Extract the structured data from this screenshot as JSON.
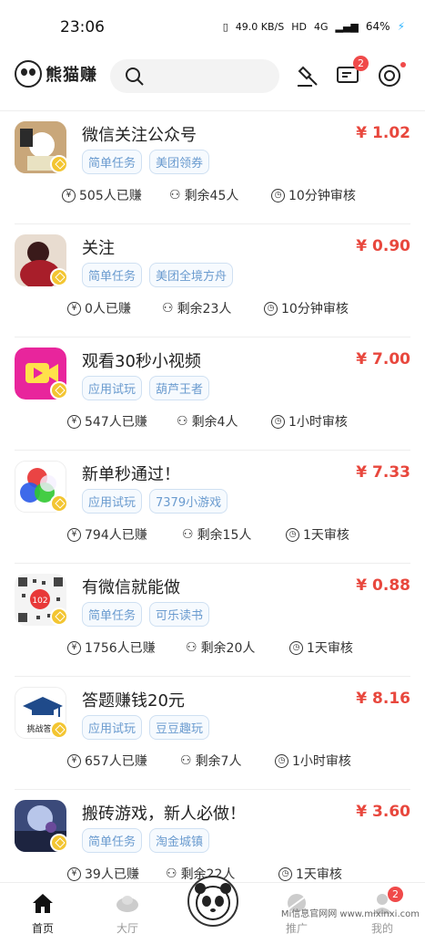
{
  "status_bar": {
    "time": "23:06",
    "net_speed": "49.0 KB/S",
    "hd": "HD",
    "signal": "4G",
    "battery": "64%"
  },
  "header": {
    "app_name": "熊猫赚",
    "search_placeholder": "",
    "message_badge": "2"
  },
  "tasks": [
    {
      "title": "微信关注公众号",
      "price": "¥ 1.02",
      "tags": [
        "简单任务",
        "美团领券"
      ],
      "earned": "505人已赚",
      "remaining": "剩余45人",
      "review": "10分钟审核",
      "thumb_color": "#c9a77a"
    },
    {
      "title": "关注",
      "price": "¥ 0.90",
      "tags": [
        "简单任务",
        "美团全境方舟"
      ],
      "earned": "0人已赚",
      "remaining": "剩余23人",
      "review": "10分钟审核",
      "thumb_color": "#8b2c2c"
    },
    {
      "title": "观看30秒小视频",
      "price": "¥ 7.00",
      "tags": [
        "应用试玩",
        "葫芦王者"
      ],
      "earned": "547人已赚",
      "remaining": "剩余4人",
      "review": "1小时审核",
      "thumb_color": "#e8259c"
    },
    {
      "title": "新单秒通过！",
      "price": "¥ 7.33",
      "tags": [
        "应用试玩",
        "7379小游戏"
      ],
      "earned": "794人已赚",
      "remaining": "剩余15人",
      "review": "1天审核",
      "thumb_color": "#ffffff"
    },
    {
      "title": "有微信就能做",
      "price": "¥ 0.88",
      "tags": [
        "简单任务",
        "可乐读书"
      ],
      "earned": "1756人已赚",
      "remaining": "剩余20人",
      "review": "1天审核",
      "thumb_color": "#f5f5f5"
    },
    {
      "title": "答题赚钱20元",
      "price": "¥ 8.16",
      "tags": [
        "应用试玩",
        "豆豆趣玩"
      ],
      "earned": "657人已赚",
      "remaining": "剩余7人",
      "review": "1小时审核",
      "thumb_color": "#ffffff"
    },
    {
      "title": "搬砖游戏，新人必做！",
      "price": "¥ 3.60",
      "tags": [
        "简单任务",
        "淘金城镇"
      ],
      "earned": "39人已赚",
      "remaining": "剩余22人",
      "review": "1天审核",
      "thumb_color": "#3b4a7a"
    }
  ],
  "thumb_texts": {
    "qr_label": "102",
    "quiz_label": "挑战答"
  },
  "nav": {
    "home": "首页",
    "hall": "大厅",
    "promo": "推广",
    "mine": "我的",
    "mine_badge": "2"
  },
  "watermark": "Mi信息官网网 www.mixinxi.com",
  "colors": {
    "price": "#e8473d",
    "tag_text": "#6a9bcf",
    "badge": "#f04a4a"
  }
}
